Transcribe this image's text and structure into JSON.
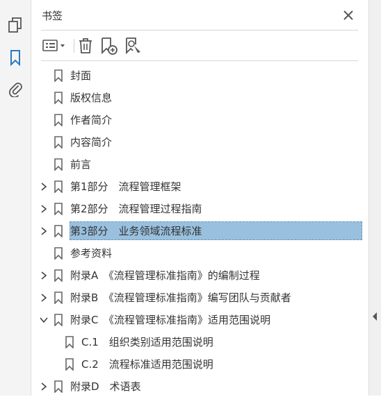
{
  "panel": {
    "title": "书签"
  },
  "rail": {
    "icons": [
      "pages-icon",
      "bookmarks-icon",
      "attachments-icon"
    ]
  },
  "toolbar": {
    "icons": [
      "options-menu-icon",
      "delete-bookmark-icon",
      "new-bookmark-icon",
      "find-bookmark-icon"
    ]
  },
  "bookmarks": [
    {
      "label": "封面",
      "expander": "none",
      "level": 0
    },
    {
      "label": "版权信息",
      "expander": "none",
      "level": 0
    },
    {
      "label": "作者简介",
      "expander": "none",
      "level": 0
    },
    {
      "label": "内容简介",
      "expander": "none",
      "level": 0
    },
    {
      "label": "前言",
      "expander": "none",
      "level": 0
    },
    {
      "label": "第1部分　流程管理框架",
      "expander": "collapsed",
      "level": 0
    },
    {
      "label": "第2部分　流程管理过程指南",
      "expander": "collapsed",
      "level": 0
    },
    {
      "label": "第3部分　业务领域流程标准",
      "expander": "collapsed",
      "level": 0,
      "selected": true
    },
    {
      "label": "参考资料",
      "expander": "none",
      "level": 0
    },
    {
      "label": "附录A　《流程管理标准指南》的编制过程",
      "expander": "collapsed",
      "level": 0
    },
    {
      "label": "附录B　《流程管理标准指南》编写团队与贡献者",
      "expander": "collapsed",
      "level": 0
    },
    {
      "label": "附录C　《流程管理标准指南》适用范围说明",
      "expander": "expanded",
      "level": 0
    },
    {
      "label": "C.1　组织类别适用范围说明",
      "expander": "none",
      "level": 1
    },
    {
      "label": "C.2　流程标准适用范围说明",
      "expander": "none",
      "level": 1
    },
    {
      "label": "附录D　术语表",
      "expander": "collapsed",
      "level": 0
    }
  ]
}
